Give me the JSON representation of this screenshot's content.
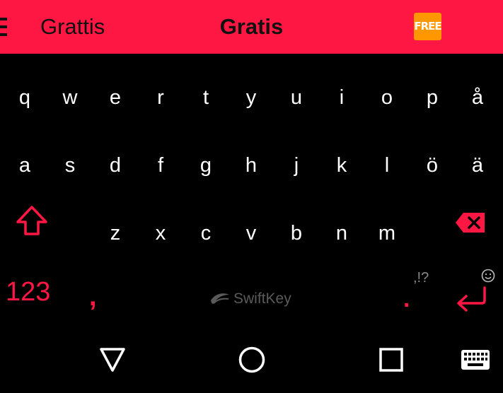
{
  "prediction_bar": {
    "left": "Grattis",
    "center": "Gratis",
    "badge": "FREE"
  },
  "keyboard": {
    "row1": [
      "q",
      "w",
      "e",
      "r",
      "t",
      "y",
      "u",
      "i",
      "o",
      "p",
      "å"
    ],
    "row2": [
      "a",
      "s",
      "d",
      "f",
      "g",
      "h",
      "j",
      "k",
      "l",
      "ö",
      "ä"
    ],
    "row3": [
      "z",
      "x",
      "c",
      "v",
      "b",
      "n",
      "m"
    ],
    "numbers_label": "123",
    "comma_label": ",",
    "brand_label": "SwiftKey",
    "punctuation_hint": ",!?",
    "period_label": "."
  },
  "colors": {
    "accent": "#ff1744",
    "badge": "#ff9800",
    "background": "#000000",
    "key_text": "#ffffff",
    "hint_text": "#8a8a8a"
  },
  "icons": {
    "menu": "menu-icon",
    "shift": "shift-icon",
    "backspace": "backspace-icon",
    "enter": "enter-icon",
    "emoji": "smiley-icon",
    "nav_back": "triangle-back-icon",
    "nav_home": "circle-home-icon",
    "nav_recent": "square-recents-icon",
    "nav_keyboard": "keyboard-icon"
  }
}
